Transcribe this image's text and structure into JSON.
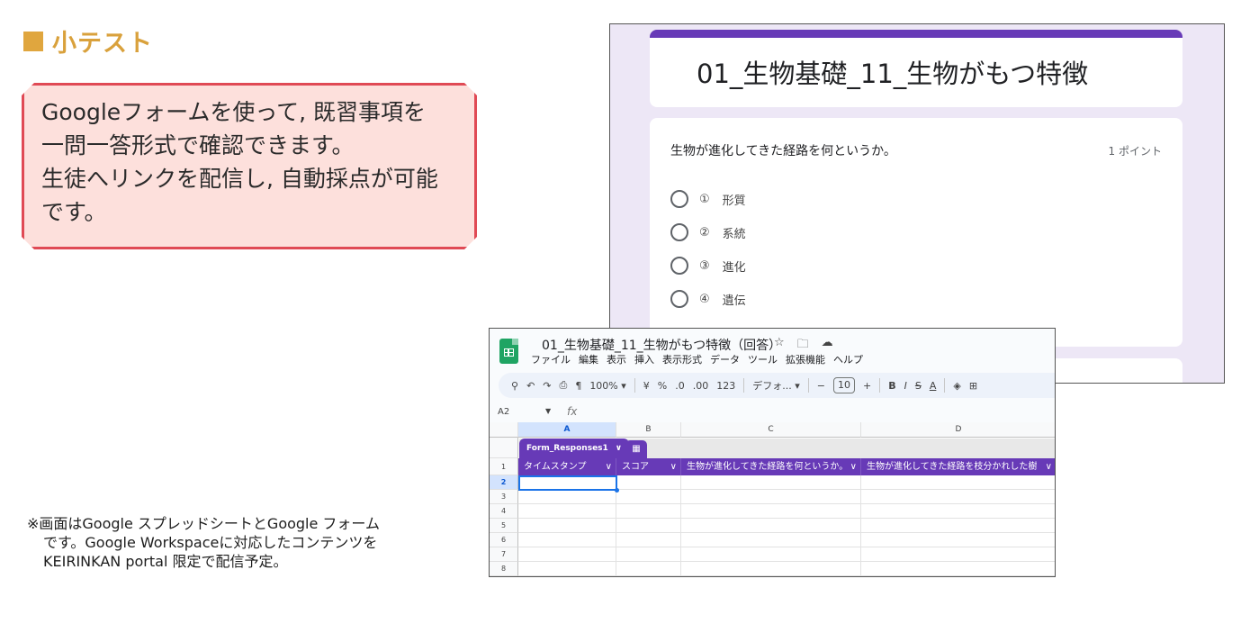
{
  "heading": {
    "text": "小テスト"
  },
  "callout": {
    "lines": [
      "Googleフォームを使って, 既習事項を",
      "一問一答形式で確認できます。",
      "生徒へリンクを配信し, 自動採点が可能",
      "です。"
    ]
  },
  "note": {
    "lines": [
      "※画面はGoogle スプレッドシートとGoogle フォーム",
      "です。Google Workspaceに対応したコンテンツを",
      "KEIRINKAN portal 限定で配信予定。"
    ]
  },
  "form": {
    "title": "01_生物基礎_11_生物がもつ特徴",
    "question": "生物が進化してきた経路を何というか。",
    "points": "1 ポイント",
    "options": [
      {
        "num": "①",
        "label": "形質"
      },
      {
        "num": "②",
        "label": "系統"
      },
      {
        "num": "③",
        "label": "進化"
      },
      {
        "num": "④",
        "label": "遺伝"
      }
    ]
  },
  "sheet": {
    "title": "01_生物基礎_11_生物がもつ特徴（回答）",
    "menu": [
      "ファイル",
      "編集",
      "表示",
      "挿入",
      "表示形式",
      "データ",
      "ツール",
      "拡張機能",
      "ヘルプ"
    ],
    "toolbar": {
      "zoom": "100%",
      "currency": "¥",
      "percent": "%",
      "dec_less": ".0",
      "dec_more": ".00",
      "num_format": "123",
      "font": "デフォ...",
      "minus": "−",
      "font_size": "10",
      "plus": "+",
      "bold": "B",
      "italic": "I",
      "strike": "S",
      "text_color": "A"
    },
    "cell_ref": "A2",
    "fx": "fx",
    "columns": [
      "A",
      "B",
      "C",
      "D"
    ],
    "table_name": "Form_Responses1",
    "headers": [
      "タイムスタンプ",
      "スコア",
      "生物が進化してきた経路を何というか。",
      "生物が進化してきた経路を枝分かれした樹"
    ],
    "rows": [
      "1",
      "2",
      "3",
      "4",
      "5",
      "6",
      "7",
      "8"
    ]
  },
  "colors": {
    "accent_orange": "#e0a63e",
    "callout_border": "#e04a55",
    "callout_fill": "#fde0dc",
    "forms_purple": "#673ab7",
    "sheets_green": "#1fa463"
  }
}
